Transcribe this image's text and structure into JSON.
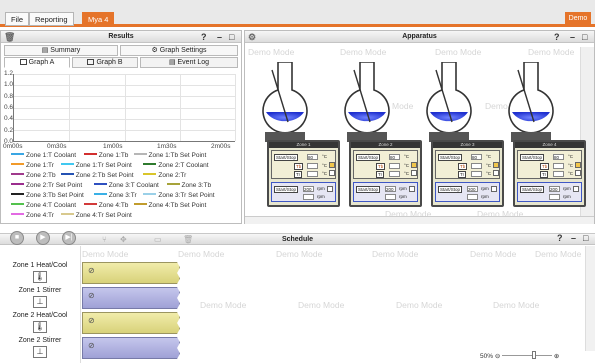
{
  "topbar": {
    "tabs": [
      {
        "label": "File"
      },
      {
        "label": "Reporting"
      },
      {
        "label": "Mya 4"
      }
    ],
    "demo_label": "Demo"
  },
  "results": {
    "title": "Results",
    "summary_label": "Summary",
    "graph_settings_label": "Graph Settings",
    "tabs": [
      {
        "label": "Graph A"
      },
      {
        "label": "Graph B"
      },
      {
        "label": "Event Log"
      }
    ],
    "y_ticks": [
      "1.2",
      "1.0",
      "0.8",
      "0.6",
      "0.4",
      "0.2",
      "0.0"
    ],
    "x_ticks": [
      "0m00s",
      "0m30s",
      "1m00s",
      "1m30s",
      "2m00s"
    ],
    "legend": [
      {
        "label": "Zone 1:T Coolant",
        "color": "#3aa6e3"
      },
      {
        "label": "Zone 1:Tb",
        "color": "#d22f2f"
      },
      {
        "label": "Zone 1:Tb Set Point",
        "color": "#b6b6b6"
      },
      {
        "label": "Zone 1:Tr",
        "color": "#f19a2a"
      },
      {
        "label": "Zone 1:Tr Set Point",
        "color": "#41c8f0"
      },
      {
        "label": "Zone 2:T Coolant",
        "color": "#2e7a2e"
      },
      {
        "label": "Zone 2:Tb",
        "color": "#a03a8c"
      },
      {
        "label": "Zone 2:Tb Set Point",
        "color": "#2452b3"
      },
      {
        "label": "Zone 2:Tr",
        "color": "#d9c52a"
      },
      {
        "label": "Zone 2:Tr Set Point",
        "color": "#9b2d8e"
      },
      {
        "label": "Zone 3:T Coolant",
        "color": "#2e50c0"
      },
      {
        "label": "Zone 3:Tb",
        "color": "#a7a33a"
      },
      {
        "label": "Zone 3:Tb Set Point",
        "color": "#222222"
      },
      {
        "label": "Zone 3:Tr",
        "color": "#3ab0e6"
      },
      {
        "label": "Zone 3:Tr Set Point",
        "color": "#9ad0e8"
      },
      {
        "label": "Zone 4:T Coolant",
        "color": "#53c24d"
      },
      {
        "label": "Zone 4:Tb",
        "color": "#d23a3a"
      },
      {
        "label": "Zone 4:Tb Set Point",
        "color": "#c19c2d"
      },
      {
        "label": "Zone 4:Tr",
        "color": "#e36ae3"
      },
      {
        "label": "Zone 4:Tr Set Point",
        "color": "#d8c98e"
      }
    ]
  },
  "apparatus": {
    "title": "Apparatus",
    "watermark": "Demo Mode",
    "zones": [
      {
        "name": "Zone 1",
        "start_stop": "Start/Stop",
        "setpoint": "80",
        "unit_c": "°C",
        "tb": "Tb",
        "tr": "Tr",
        "rpm_value": "200",
        "rpm_unit": "rpm"
      },
      {
        "name": "Zone 2",
        "start_stop": "Start/Stop",
        "setpoint": "80",
        "unit_c": "°C",
        "tb": "Tb",
        "tr": "Tr",
        "rpm_value": "200",
        "rpm_unit": "rpm"
      },
      {
        "name": "Zone 3",
        "start_stop": "Start/Stop",
        "setpoint": "80",
        "unit_c": "°C",
        "tb": "Tb",
        "tr": "Tr",
        "rpm_value": "200",
        "rpm_unit": "rpm"
      },
      {
        "name": "Zone 4",
        "start_stop": "Start/Stop",
        "setpoint": "80",
        "unit_c": "°C",
        "tb": "Tb",
        "tr": "Tr",
        "rpm_value": "200",
        "rpm_unit": "rpm"
      }
    ]
  },
  "schedule": {
    "title": "Schedule",
    "watermark": "Demo Mode",
    "rows": [
      {
        "label": "Zone 1 Heat/Cool",
        "icon": "thermometer-icon",
        "bar": "yellow"
      },
      {
        "label": "Zone 1 Stirrer",
        "icon": "stirrer-icon",
        "bar": "purple"
      },
      {
        "label": "Zone 2 Heat/Cool",
        "icon": "thermometer-icon",
        "bar": "yellow"
      },
      {
        "label": "Zone 2 Stirrer",
        "icon": "stirrer-icon",
        "bar": "purple"
      }
    ],
    "zoom_label": "50%"
  }
}
